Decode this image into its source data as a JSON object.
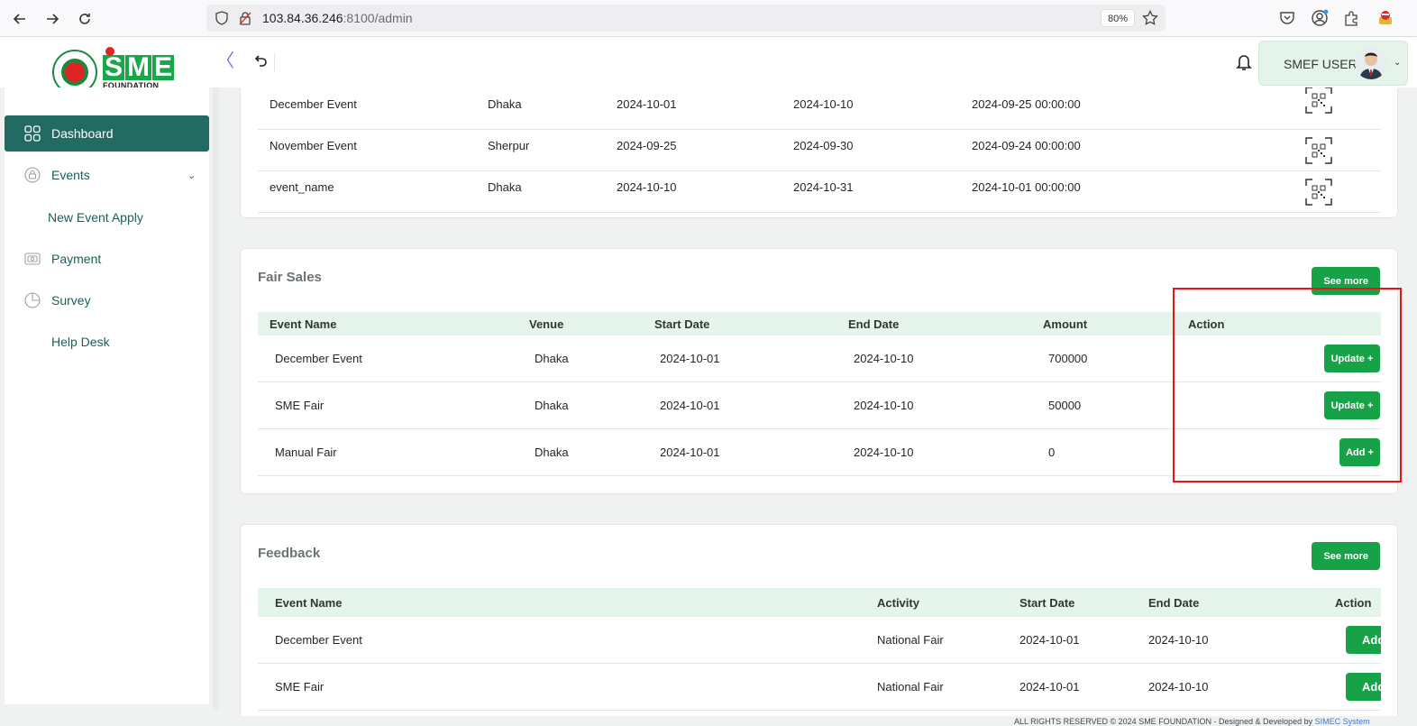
{
  "browser": {
    "url_host": "103.84.36.246",
    "url_rest": ":8100/admin",
    "zoom": "80%"
  },
  "header": {
    "logo_text": "SME",
    "logo_subtext": "FOUNDATION",
    "user_name": "SMEF USER"
  },
  "sidebar": {
    "items": [
      {
        "label": "Dashboard",
        "icon": "grid-icon"
      },
      {
        "label": "Events",
        "icon": "lock-icon"
      },
      {
        "label": "New Event Apply"
      },
      {
        "label": "Payment",
        "icon": "payment-icon"
      },
      {
        "label": "Survey",
        "icon": "pie-icon"
      },
      {
        "label": "Help Desk"
      }
    ]
  },
  "events_table": {
    "rows": [
      {
        "name": "December Event",
        "venue": "Dhaka",
        "start": "2024-10-01",
        "end": "2024-10-10",
        "created": "2024-09-25 00:00:00"
      },
      {
        "name": "November Event",
        "venue": "Sherpur",
        "start": "2024-09-25",
        "end": "2024-09-30",
        "created": "2024-09-24 00:00:00"
      },
      {
        "name": "event_name",
        "venue": "Dhaka",
        "start": "2024-10-10",
        "end": "2024-10-31",
        "created": "2024-10-01 00:00:00"
      }
    ]
  },
  "fair_sales": {
    "title": "Fair Sales",
    "see_more": "See more",
    "headers": [
      "Event Name",
      "Venue",
      "Start Date",
      "End Date",
      "Amount",
      "Action"
    ],
    "rows": [
      {
        "name": "December Event",
        "venue": "Dhaka",
        "start": "2024-10-01",
        "end": "2024-10-10",
        "amount": "700000",
        "action": "Update +"
      },
      {
        "name": "SME Fair",
        "venue": "Dhaka",
        "start": "2024-10-01",
        "end": "2024-10-10",
        "amount": "50000",
        "action": "Update +"
      },
      {
        "name": "Manual Fair",
        "venue": "Dhaka",
        "start": "2024-10-01",
        "end": "2024-10-10",
        "amount": "0",
        "action": "Add +"
      }
    ]
  },
  "feedback": {
    "title": "Feedback",
    "see_more": "See more",
    "headers": [
      "Event Name",
      "Activity",
      "Start Date",
      "End Date",
      "Action"
    ],
    "rows": [
      {
        "name": "December Event",
        "activity": "National Fair",
        "start": "2024-10-01",
        "end": "2024-10-10",
        "action": "Add"
      },
      {
        "name": "SME Fair",
        "activity": "National Fair",
        "start": "2024-10-01",
        "end": "2024-10-10",
        "action": "Add"
      }
    ]
  },
  "footer": {
    "text": "ALL RIGHTS RESERVED © 2024 SME FOUNDATION - Designed & Developed by",
    "link": "SIMEC System"
  },
  "colors": {
    "primary": "#226b63",
    "accent_green": "#18a248",
    "header_row": "#e6f5eb",
    "highlight": "#e81515"
  }
}
